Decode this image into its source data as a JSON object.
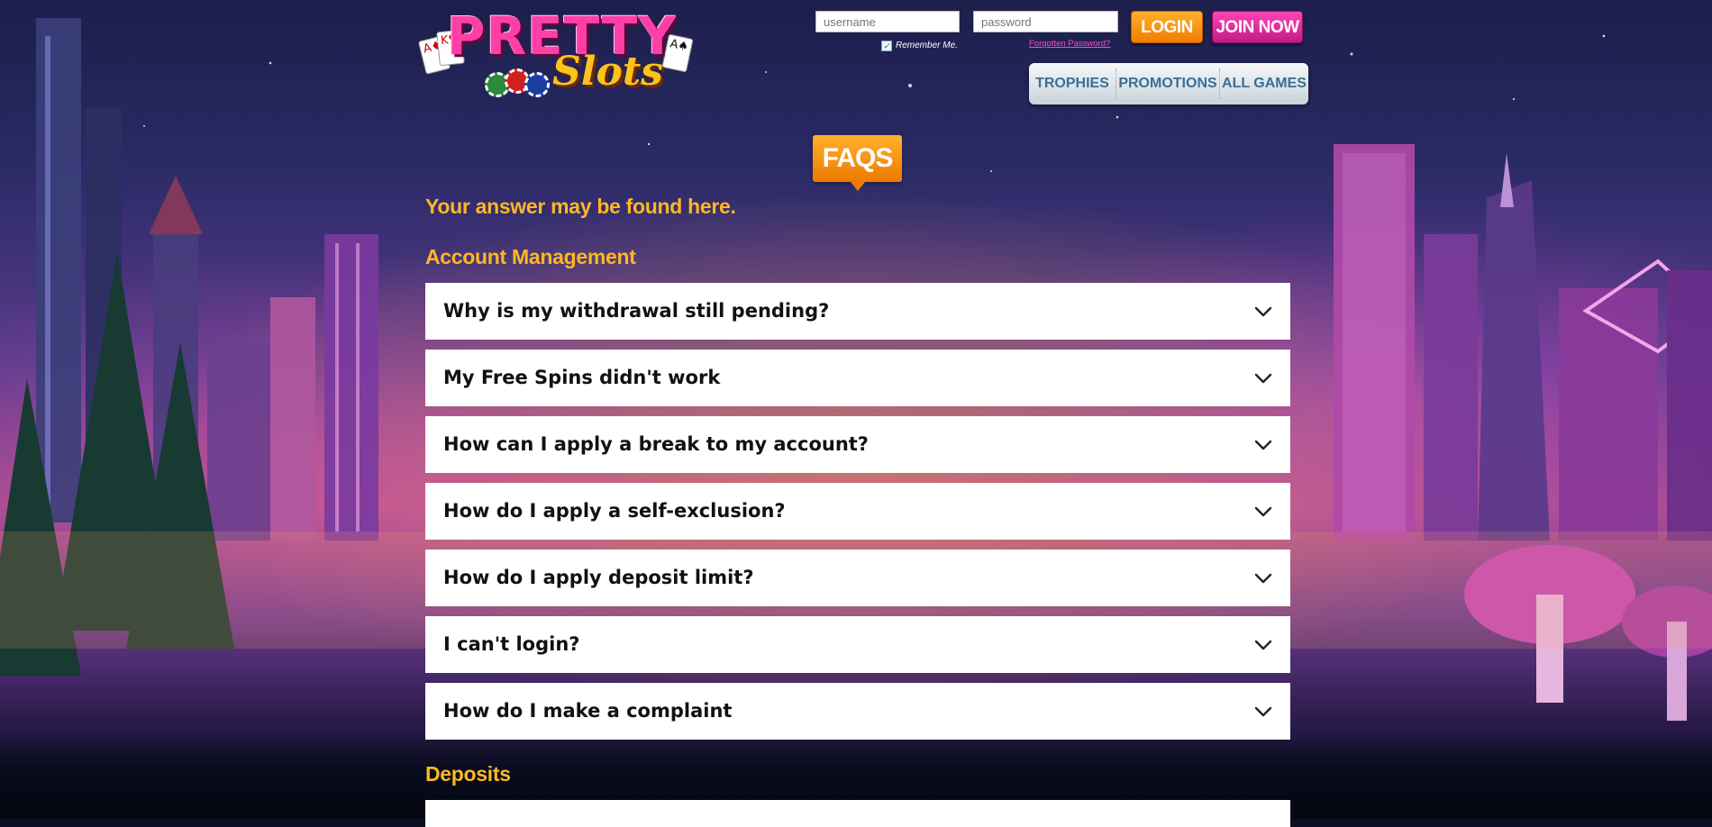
{
  "brand": {
    "logo_top": "PRETTY",
    "logo_bottom": "Slots",
    "logo_card_suits": [
      "A♦",
      "K♥",
      "A♠"
    ]
  },
  "login": {
    "username_placeholder": "username",
    "password_placeholder": "password",
    "remember_label": "Remember Me.",
    "remember_checked": true,
    "forgot_label": "Forgotten Password?",
    "login_label": "LOGIN",
    "join_label": "JOIN NOW"
  },
  "nav": {
    "items": [
      "TROPHIES",
      "PROMOTIONS",
      "ALL GAMES"
    ]
  },
  "page": {
    "badge": "FAQS",
    "subtitle": "Your answer may be found here."
  },
  "sections": [
    {
      "title": "Account Management",
      "questions": [
        "Why is my withdrawal still pending?",
        "My Free Spins didn't work",
        "How can I apply a break to my account?",
        "How do I apply a self-exclusion?",
        "How do I apply deposit limit?",
        "I can't login?",
        "How do I make a complaint"
      ]
    },
    {
      "title": "Deposits",
      "questions": []
    }
  ],
  "colors": {
    "accent_orange": "#ffb726",
    "login_orange": "#f07c00",
    "join_pink": "#c01c86",
    "nav_text": "#3a6f95",
    "forgot_link": "#ff4db3"
  },
  "icons": {
    "faq_toggle": "chevron-down-icon",
    "remember_check": "checkbox-check-icon"
  }
}
